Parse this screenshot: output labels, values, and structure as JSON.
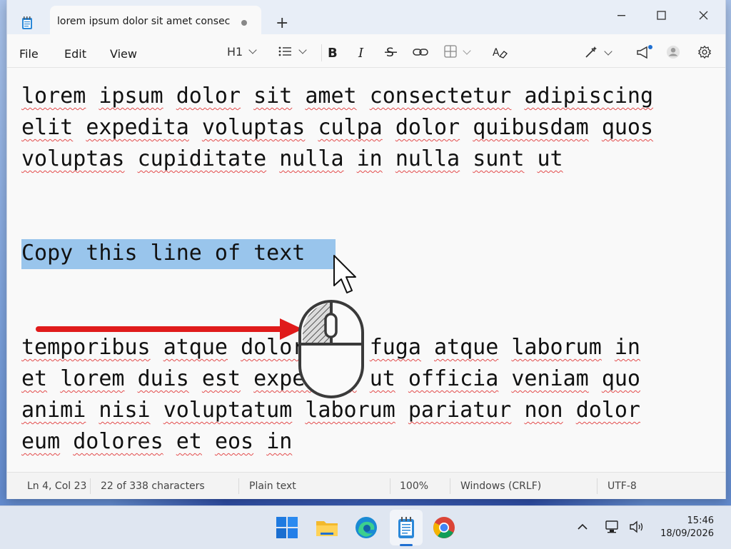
{
  "window": {
    "tab_title": "lorem ipsum dolor sit amet consec",
    "new_tab_symbol": "+",
    "controls": {
      "minimize": "—",
      "maximize": "☐",
      "close": "✕"
    }
  },
  "menubar": {
    "items": [
      "File",
      "Edit",
      "View"
    ],
    "heading": "H1"
  },
  "editor": {
    "paragraph1": [
      [
        "lorem",
        "ipsum",
        "dolor",
        "sit",
        "amet",
        "consectetur",
        "adipiscing"
      ],
      [
        "elit",
        "expedita",
        "voluptas",
        "culpa",
        "dolor",
        "quibusdam",
        "quos"
      ],
      [
        "voluptas",
        "cupiditate",
        "nulla",
        "in",
        "nulla",
        "sunt",
        "ut"
      ]
    ],
    "selected_line": "Copy this line of text",
    "paragraph2": [
      [
        "temporibus",
        "atque",
        "dolor",
        "quo",
        "fuga",
        "atque",
        "laborum",
        "in"
      ],
      [
        "et",
        "lorem",
        "duis",
        "est",
        "expedita",
        "ut",
        "officia",
        "veniam",
        "quo"
      ],
      [
        "animi",
        "nisi",
        "voluptatum",
        "laborum",
        "pariatur",
        "non",
        "dolor"
      ],
      [
        "eum",
        "dolores",
        "et",
        "eos",
        "in"
      ]
    ]
  },
  "status": {
    "position": "Ln 4, Col 23",
    "characters": "22 of 338 characters",
    "format": "Plain text",
    "zoom": "100%",
    "line_ending": "Windows (CRLF)",
    "encoding": "UTF-8"
  },
  "taskbar": {
    "time": "15:46",
    "date": "18/09/2026"
  },
  "colors": {
    "selection": "#99c5ec",
    "annotation_arrow": "#e01b1b",
    "accent": "#1f6fd1"
  }
}
